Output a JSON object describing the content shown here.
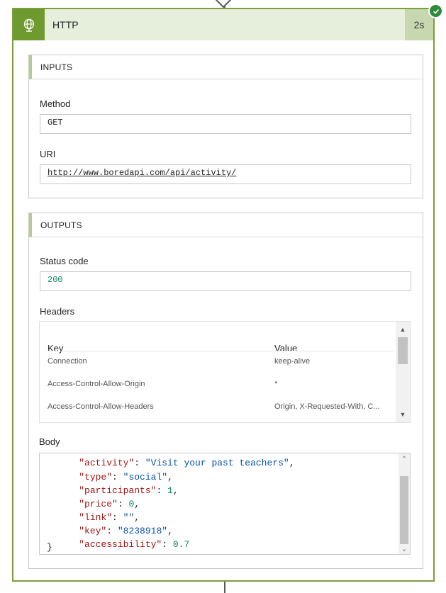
{
  "card": {
    "title": "HTTP",
    "duration": "2s",
    "icon": "globe-icon",
    "status": "succeeded",
    "accent_color": "#6f9a2f"
  },
  "inputs": {
    "section_title": "INPUTS",
    "method_label": "Method",
    "method_value": "GET",
    "uri_label": "URI",
    "uri_value": "http://www.boredapi.com/api/activity/"
  },
  "outputs": {
    "section_title": "OUTPUTS",
    "status_label": "Status code",
    "status_value": "200",
    "headers_label": "Headers",
    "headers_columns": [
      "Key",
      "Value"
    ],
    "headers_rows": [
      {
        "key": "Connection",
        "value": "keep-alive"
      },
      {
        "key": "Access-Control-Allow-Origin",
        "value": "*"
      },
      {
        "key": "Access-Control-Allow-Headers",
        "value": "Origin, X-Requested-With, C..."
      }
    ],
    "body_label": "Body",
    "body_lines": [
      {
        "key": "\"activity\"",
        "value": "\"Visit your past teachers\"",
        "vtype": "string",
        "trail": ","
      },
      {
        "key": "\"type\"",
        "value": "\"social\"",
        "vtype": "string",
        "trail": ","
      },
      {
        "key": "\"participants\"",
        "value": "1",
        "vtype": "number",
        "trail": ","
      },
      {
        "key": "\"price\"",
        "value": "0",
        "vtype": "number",
        "trail": ","
      },
      {
        "key": "\"link\"",
        "value": "\"\"",
        "vtype": "string",
        "trail": ","
      },
      {
        "key": "\"key\"",
        "value": "\"8238918\"",
        "vtype": "string",
        "trail": ","
      },
      {
        "key": "\"accessibility\"",
        "value": "0.7",
        "vtype": "number",
        "trail": ""
      }
    ],
    "body_close": "}"
  }
}
